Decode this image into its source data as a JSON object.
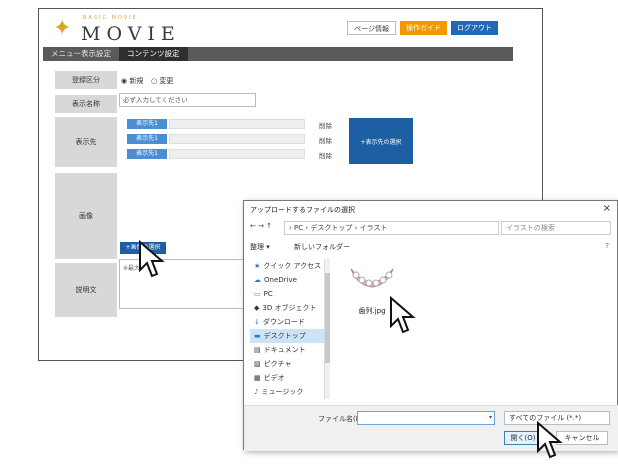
{
  "app": {
    "tagline": "BASIC  MOVIE",
    "brand": "MOVIE"
  },
  "topbar": {
    "page_info": "ページ情報",
    "guide": "操作ガイド",
    "logout": "ログアウト"
  },
  "nav": {
    "tabs": [
      "メニュー表示設定",
      "コンテンツ設定"
    ]
  },
  "form": {
    "reg_type_label": "登録区分",
    "radio_new": "◉ 新規",
    "radio_change": "○ 変更",
    "display_name_label": "表示名称",
    "display_name_placeholder": "必ず入力してください",
    "dest_label": "表示先",
    "dest_btn": "表示先1",
    "delete": "削除",
    "add_dest": "+表示先の選択",
    "image_label": "画像",
    "image_btn": "+画像の選択",
    "bio_label": "説明文",
    "bio_placeholder": "※最大"
  },
  "dialog": {
    "title": "アップロードするファイルの選択",
    "close": "×",
    "path": "› PC › デスクトップ › イラスト",
    "search_placeholder": "イラストの検索",
    "organize": "整理 ▾",
    "new_folder": "新しいフォルダー",
    "sidebar": [
      "クイック アクセス",
      "OneDrive",
      "PC",
      "3D オブジェクト",
      "ダウンロード",
      "デスクトップ",
      "ドキュメント",
      "ピクチャ",
      "ビデオ",
      "ミュージック"
    ],
    "file_name": "歯列.jpg",
    "fn_label": "ファイル名(N):",
    "file_type": "すべてのファイル (*.*)",
    "open": "開く(O)",
    "cancel": "キャンセル"
  }
}
